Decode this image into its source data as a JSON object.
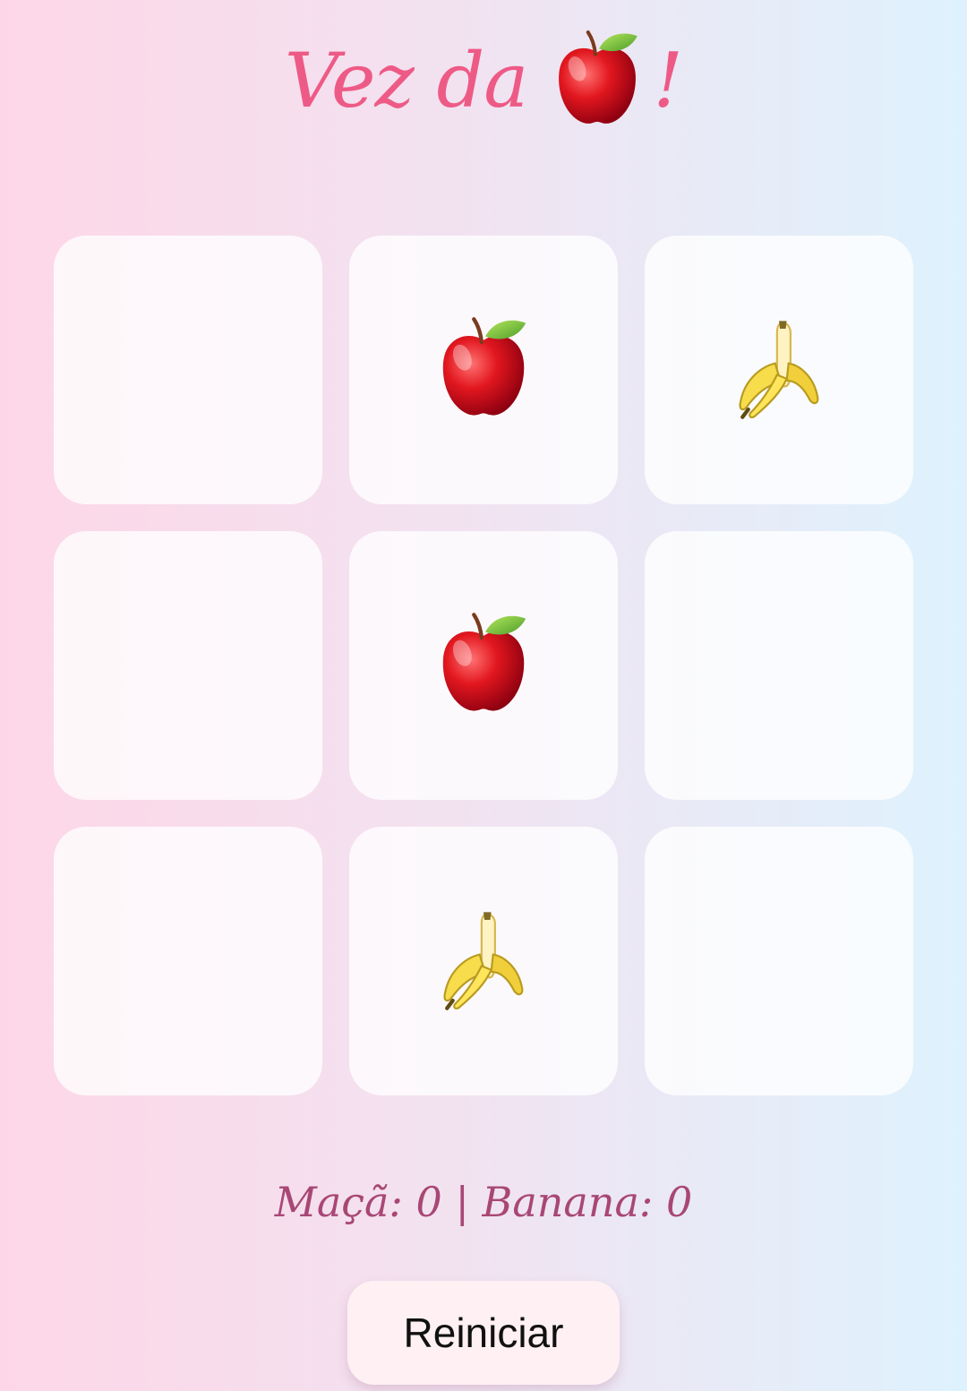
{
  "title": {
    "prefix": "Vez da",
    "turn_icon": "apple-icon",
    "suffix": "!"
  },
  "board": {
    "cells": [
      "",
      "apple",
      "banana",
      "",
      "apple",
      "",
      "",
      "banana",
      ""
    ]
  },
  "score": {
    "text": "Maçã: 0 | Banana: 0"
  },
  "restart": {
    "label": "Reiniciar"
  },
  "colors": {
    "title": "#ee5a86",
    "score": "#a84775",
    "cell_bg": "#fffafc",
    "button_bg": "#fff0f3",
    "apple": "#e2171f",
    "banana": "#f7dc4b"
  }
}
